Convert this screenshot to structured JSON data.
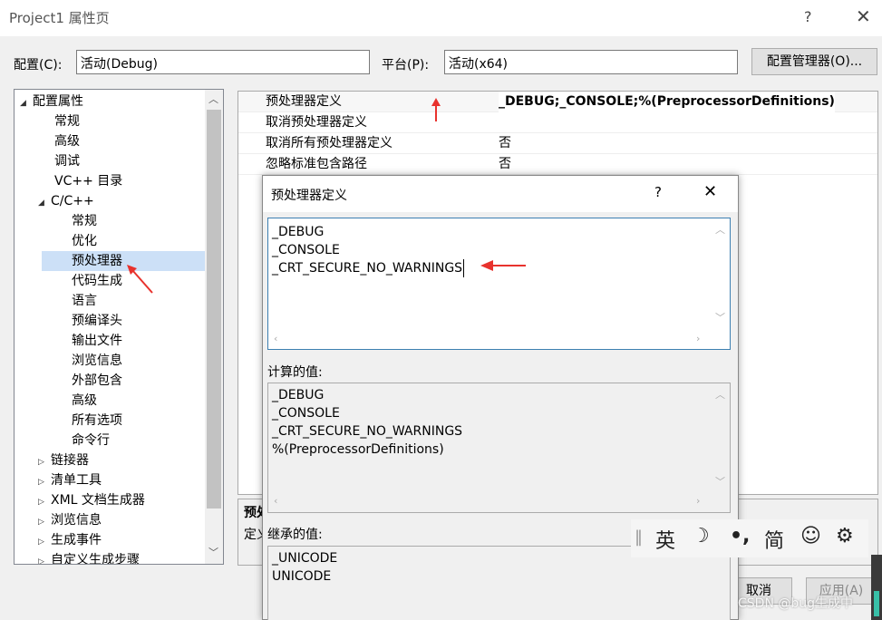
{
  "window": {
    "title": "Project1 属性页",
    "help": "?",
    "close": "✕"
  },
  "toolbar": {
    "config_label": "配置(C):",
    "config_value": "活动(Debug)",
    "platform_label": "平台(P):",
    "platform_value": "活动(x64)",
    "config_manager": "配置管理器(O)..."
  },
  "tree": {
    "items": [
      {
        "label": "配置属性",
        "expand": "◢"
      },
      {
        "label": "常规"
      },
      {
        "label": "高级"
      },
      {
        "label": "调试"
      },
      {
        "label": "VC++ 目录"
      },
      {
        "label": "C/C++",
        "expand": "◢"
      },
      {
        "label": "常规"
      },
      {
        "label": "优化"
      },
      {
        "label": "预处理器"
      },
      {
        "label": "代码生成"
      },
      {
        "label": "语言"
      },
      {
        "label": "预编译头"
      },
      {
        "label": "输出文件"
      },
      {
        "label": "浏览信息"
      },
      {
        "label": "外部包含"
      },
      {
        "label": "高级"
      },
      {
        "label": "所有选项"
      },
      {
        "label": "命令行"
      },
      {
        "label": "链接器",
        "expand": "▷"
      },
      {
        "label": "清单工具",
        "expand": "▷"
      },
      {
        "label": "XML 文档生成器",
        "expand": "▷"
      },
      {
        "label": "浏览信息",
        "expand": "▷"
      },
      {
        "label": "生成事件",
        "expand": "▷"
      },
      {
        "label": "自定义生成步骤",
        "expand": "▷"
      }
    ]
  },
  "grid": {
    "rows": [
      {
        "key": "预处理器定义",
        "value": "_DEBUG;_CONSOLE;%(PreprocessorDefinitions)"
      },
      {
        "key": "取消预处理器定义",
        "value": ""
      },
      {
        "key": "取消所有预处理器定义",
        "value": "否"
      },
      {
        "key": "忽略标准包含路径",
        "value": "否"
      }
    ]
  },
  "description": {
    "title": "预处",
    "text": "定义"
  },
  "dialog": {
    "title": "预处理器定义",
    "help": "?",
    "close": "✕",
    "edit_lines": [
      "_DEBUG",
      "_CONSOLE",
      "_CRT_SECURE_NO_WARNINGS"
    ],
    "computed_label": "计算的值:",
    "computed_lines": [
      "_DEBUG",
      "_CONSOLE",
      "_CRT_SECURE_NO_WARNINGS",
      "%(PreprocessorDefinitions)"
    ],
    "inherited_label": "继承的值:",
    "inherited_lines": [
      "_UNICODE",
      "UNICODE"
    ]
  },
  "buttons": {
    "cancel": "取消",
    "apply": "应用(A)"
  },
  "ime": {
    "lang": "英",
    "moon": "☽",
    "punct": "•,",
    "simp": "简",
    "smile": "☺",
    "gear": "⚙"
  },
  "watermark": "CSDN @bug生成中",
  "colors": {
    "selection": "#cce0f7",
    "arrow": "#e8322d"
  }
}
